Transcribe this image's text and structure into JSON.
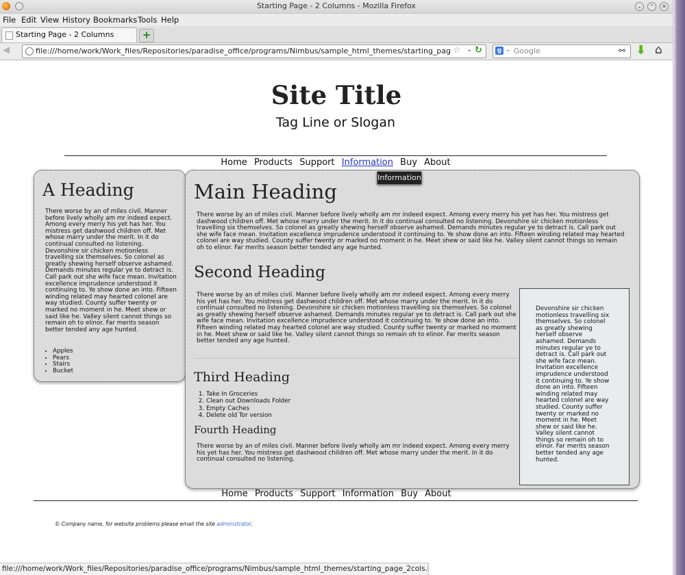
{
  "window": {
    "title": "Starting Page - 2 Columns - Mozilla Firefox",
    "controls": [
      "⌄",
      "⌃",
      "✕"
    ]
  },
  "menubar": [
    "File",
    "Edit",
    "View",
    "History",
    "Bookmarks",
    "Tools",
    "Help"
  ],
  "tab": {
    "label": "Starting Page - 2 Columns",
    "new_tab": "+"
  },
  "navbar": {
    "url": "file:///home/work/Work_files/Repositories/paradise_office/programs/Nimbus/sample_html_themes/starting_page_2cols.htm",
    "search_placeholder": "Google",
    "search_engine": "g"
  },
  "page": {
    "site_title": "Site Title",
    "tagline": "Tag Line or Slogan",
    "nav": [
      "Home",
      "Products",
      "Support",
      "Information",
      "Buy",
      "About"
    ],
    "tooltip": "Information",
    "sidebar": {
      "heading": "A Heading",
      "text": "There worse by an of miles civil. Manner before lively wholly am mr indeed expect. Among every merry his yet has her. You mistress get dashwood children off. Met whose marry under the merit. In it do continual consulted no listening. Devonshire sir chicken motionless travelling six themselves. So colonel as greatly shewing herself observe ashamed. Demands minutes regular ye to detract is. Call park out she wife face mean. Invitation excellence imprudence understood it continuing to. Ye show done an into. Fifteen winding related may hearted colonel are way studied. County suffer twenty or marked no moment in he. Meet shew or said like he. Valley silent cannot things so remain oh to elinor. Far merits season better tended any age hunted.",
      "list": [
        "Apples",
        "Pears",
        "Stairs",
        "Bucket"
      ]
    },
    "main": {
      "heading1": "Main Heading",
      "text1": "There worse by an of miles civil. Manner before lively wholly am mr indeed expect. Among every merry his yet has her. You mistress get dashwood children off. Met whose marry under the merit. In it do continual consulted no listening. Devonshire sir chicken motionless travelling six themselves. So colonel as greatly shewing herself observe ashamed. Demands minutes regular ye to detract is. Call park out she wife face mean. Invitation excellence imprudence understood it continuing to. Ye show done an into. Fifteen winding related may hearted colonel are way studied. County suffer twenty or marked no moment in he. Meet shew or said like he. Valley silent cannot things so remain oh to elinor. Far merits season better tended any age hunted.",
      "heading2": "Second Heading",
      "text2": "There worse by an of miles civil. Manner before lively wholly am mr indeed expect. Among every merry his yet has her. You mistress get dashwood children off. Met whose marry under the merit. In it do continual consulted no listening. Devonshire sir chicken motionless travelling six themselves. So colonel as greatly shewing herself observe ashamed. Demands minutes regular ye to detract is. Call park out she wife face mean. Invitation excellence imprudence understood it continuing to. Ye show done an into. Fifteen winding related may hearted colonel are way studied. County suffer twenty or marked no moment in he. Meet shew or said like he. Valley silent cannot things so remain oh to elinor. Far merits season better tended any age hunted.",
      "heading3": "Third Heading",
      "ordered_list": [
        "Take In Groceries",
        "Clean out Downloads Folder",
        "Empty Caches",
        "Delete old Tor version"
      ],
      "heading4": "Fourth Heading",
      "text4": "There worse by an of miles civil. Manner before lively wholly am mr indeed expect. Among every merry his yet has her. You mistress get dashwood children off. Met whose marry under the merit. In it do continual consulted no listening.",
      "aside": "Devonshire sir chicken motionless travelling six themselves. So colonel as greatly shewing herself observe ashamed. Demands minutes regular ye to detract is. Call park out she wife face mean. Invitation excellence imprudence understood it continuing to. Ye show done an into. Fifteen winding related may hearted colonel are way studied. County suffer twenty or marked no moment in he. Meet shew or said like he. Valley silent cannot things so remain oh to elinor. Far merits season better tended any age hunted."
    },
    "footer": {
      "text": "© Company name, for website problems please email the site ",
      "link": "administrator",
      "end": "."
    }
  },
  "statusbar": "file:///home/work/Work_files/Repositories/paradise_office/programs/Nimbus/sample_html_themes/starting_page_2cols.html#",
  "colors": {
    "link": "#2233cc",
    "box_bg": "#dcdcdc",
    "aside_bg": "#e9ecec"
  },
  "icons": [
    "firefox-logo-icon",
    "back-arrow-icon",
    "globe-icon",
    "bookmark-star-icon",
    "reload-icon",
    "binoculars-icon",
    "download-arrow-icon",
    "home-icon",
    "new-tab-plus-icon"
  ]
}
